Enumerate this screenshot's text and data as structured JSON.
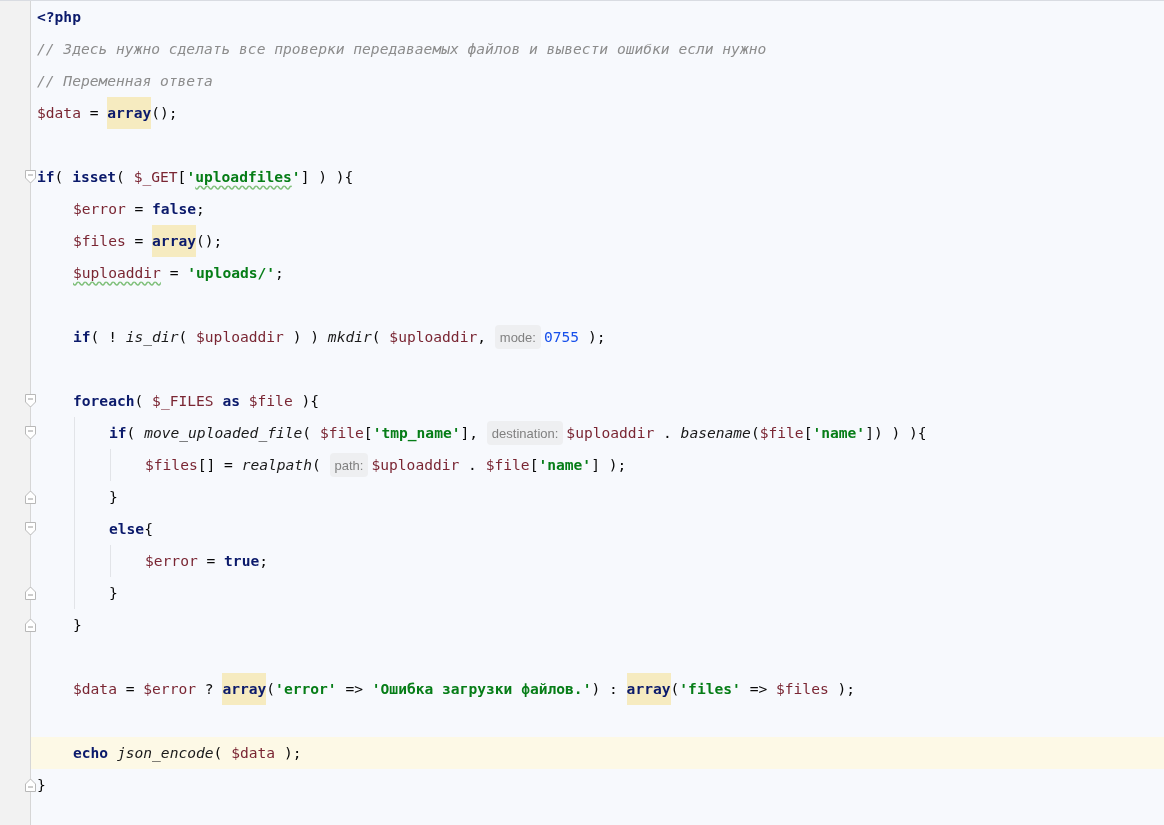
{
  "editor": {
    "lines": [
      {
        "kind": "code",
        "tokens": [
          {
            "kind": "keyword",
            "text": "<?php"
          }
        ]
      },
      {
        "kind": "code",
        "tokens": [
          {
            "kind": "comment",
            "text": "// Здесь нужно сделать все проверки передаваемых файлов и вывести ошибки если нужно"
          }
        ]
      },
      {
        "kind": "code",
        "tokens": [
          {
            "kind": "comment",
            "text": "// Переменная ответа"
          }
        ]
      },
      {
        "kind": "code",
        "tokens": [
          {
            "kind": "variable",
            "text": "$data"
          },
          {
            "kind": "plain",
            "text": " = "
          },
          {
            "kind": "marked",
            "text": "array"
          },
          {
            "kind": "plain",
            "text": "();"
          }
        ]
      },
      {
        "kind": "blank"
      },
      {
        "kind": "block_open",
        "tokens": [
          {
            "kind": "keyword",
            "text": "if"
          },
          {
            "kind": "plain",
            "text": "( "
          },
          {
            "kind": "keyword",
            "text": "isset"
          },
          {
            "kind": "plain",
            "text": "( "
          },
          {
            "kind": "variable",
            "text": "$_GET"
          },
          {
            "kind": "plain",
            "text": "["
          },
          {
            "kind": "string",
            "text": "'"
          },
          {
            "kind": "string_typo",
            "text": "uploadfiles"
          },
          {
            "kind": "string",
            "text": "'"
          },
          {
            "kind": "plain",
            "text": "] ) ){"
          }
        ],
        "children": [
          {
            "kind": "code",
            "tokens": [
              {
                "kind": "variable",
                "text": "$error"
              },
              {
                "kind": "plain",
                "text": " = "
              },
              {
                "kind": "keyword",
                "text": "false"
              },
              {
                "kind": "plain",
                "text": ";"
              }
            ]
          },
          {
            "kind": "code",
            "tokens": [
              {
                "kind": "variable",
                "text": "$files"
              },
              {
                "kind": "plain",
                "text": " = "
              },
              {
                "kind": "marked",
                "text": "array"
              },
              {
                "kind": "plain",
                "text": "();"
              }
            ]
          },
          {
            "kind": "code",
            "tokens": [
              {
                "kind": "variable_typo",
                "text": "$uploaddir"
              },
              {
                "kind": "plain",
                "text": " = "
              },
              {
                "kind": "string",
                "text": "'uploads/'"
              },
              {
                "kind": "plain",
                "text": ";"
              }
            ]
          },
          {
            "kind": "blank"
          },
          {
            "kind": "code",
            "tokens": [
              {
                "kind": "keyword",
                "text": "if"
              },
              {
                "kind": "plain",
                "text": "( ! "
              },
              {
                "kind": "function",
                "text": "is_dir"
              },
              {
                "kind": "plain",
                "text": "( "
              },
              {
                "kind": "variable",
                "text": "$uploaddir"
              },
              {
                "kind": "plain",
                "text": " ) ) "
              },
              {
                "kind": "function",
                "text": "mkdir"
              },
              {
                "kind": "plain",
                "text": "( "
              },
              {
                "kind": "variable",
                "text": "$uploaddir"
              },
              {
                "kind": "plain",
                "text": ", "
              },
              {
                "kind": "hint",
                "text": "mode:"
              },
              {
                "kind": "number",
                "text": "0755"
              },
              {
                "kind": "plain",
                "text": " );"
              }
            ]
          },
          {
            "kind": "blank"
          },
          {
            "kind": "block_open",
            "tokens": [
              {
                "kind": "keyword",
                "text": "foreach"
              },
              {
                "kind": "plain",
                "text": "( "
              },
              {
                "kind": "variable",
                "text": "$_FILES"
              },
              {
                "kind": "keyword",
                "text": " as "
              },
              {
                "kind": "variable",
                "text": "$file"
              },
              {
                "kind": "plain",
                "text": " ){"
              }
            ],
            "children": [
              {
                "kind": "block_open",
                "tokens": [
                  {
                    "kind": "keyword",
                    "text": "if"
                  },
                  {
                    "kind": "plain",
                    "text": "( "
                  },
                  {
                    "kind": "function",
                    "text": "move_uploaded_file"
                  },
                  {
                    "kind": "plain",
                    "text": "( "
                  },
                  {
                    "kind": "variable",
                    "text": "$file"
                  },
                  {
                    "kind": "plain",
                    "text": "["
                  },
                  {
                    "kind": "string",
                    "text": "'tmp_name'"
                  },
                  {
                    "kind": "plain",
                    "text": "], "
                  },
                  {
                    "kind": "hint",
                    "text": "destination:"
                  },
                  {
                    "kind": "variable",
                    "text": "$uploaddir"
                  },
                  {
                    "kind": "plain",
                    "text": " . "
                  },
                  {
                    "kind": "function",
                    "text": "basename"
                  },
                  {
                    "kind": "plain",
                    "text": "("
                  },
                  {
                    "kind": "variable",
                    "text": "$file"
                  },
                  {
                    "kind": "plain",
                    "text": "["
                  },
                  {
                    "kind": "string",
                    "text": "'name'"
                  },
                  {
                    "kind": "plain",
                    "text": "]) ) ){"
                  }
                ],
                "children": [
                  {
                    "kind": "code",
                    "tokens": [
                      {
                        "kind": "variable",
                        "text": "$files"
                      },
                      {
                        "kind": "plain",
                        "text": "[] = "
                      },
                      {
                        "kind": "function",
                        "text": "realpath"
                      },
                      {
                        "kind": "plain",
                        "text": "( "
                      },
                      {
                        "kind": "hint",
                        "text": "path:"
                      },
                      {
                        "kind": "variable",
                        "text": "$uploaddir"
                      },
                      {
                        "kind": "plain",
                        "text": " . "
                      },
                      {
                        "kind": "variable",
                        "text": "$file"
                      },
                      {
                        "kind": "plain",
                        "text": "["
                      },
                      {
                        "kind": "string",
                        "text": "'name'"
                      },
                      {
                        "kind": "plain",
                        "text": "] );"
                      }
                    ]
                  }
                ]
              },
              {
                "kind": "block_close",
                "tokens": [
                  {
                    "kind": "plain",
                    "text": "}"
                  }
                ]
              },
              {
                "kind": "block_open",
                "tokens": [
                  {
                    "kind": "keyword",
                    "text": "else"
                  },
                  {
                    "kind": "plain",
                    "text": "{"
                  }
                ],
                "children": [
                  {
                    "kind": "code",
                    "tokens": [
                      {
                        "kind": "variable",
                        "text": "$error"
                      },
                      {
                        "kind": "plain",
                        "text": " = "
                      },
                      {
                        "kind": "keyword",
                        "text": "true"
                      },
                      {
                        "kind": "plain",
                        "text": ";"
                      }
                    ]
                  }
                ]
              },
              {
                "kind": "block_close",
                "tokens": [
                  {
                    "kind": "plain",
                    "text": "}"
                  }
                ]
              }
            ]
          },
          {
            "kind": "block_close",
            "tokens": [
              {
                "kind": "plain",
                "text": "}"
              }
            ]
          },
          {
            "kind": "blank"
          },
          {
            "kind": "code",
            "tokens": [
              {
                "kind": "variable",
                "text": "$data"
              },
              {
                "kind": "plain",
                "text": " = "
              },
              {
                "kind": "variable",
                "text": "$error"
              },
              {
                "kind": "plain",
                "text": " ? "
              },
              {
                "kind": "marked",
                "text": "array"
              },
              {
                "kind": "plain",
                "text": "("
              },
              {
                "kind": "string",
                "text": "'error'"
              },
              {
                "kind": "plain",
                "text": " => "
              },
              {
                "kind": "string",
                "text": "'Ошибка загрузки файлов.'"
              },
              {
                "kind": "plain",
                "text": ") : "
              },
              {
                "kind": "marked",
                "text": "array"
              },
              {
                "kind": "plain",
                "text": "("
              },
              {
                "kind": "string",
                "text": "'files'"
              },
              {
                "kind": "plain",
                "text": " => "
              },
              {
                "kind": "variable",
                "text": "$files"
              },
              {
                "kind": "plain",
                "text": " );"
              }
            ]
          },
          {
            "kind": "blank"
          },
          {
            "kind": "code",
            "current": true,
            "tokens": [
              {
                "kind": "keyword",
                "text": "echo"
              },
              {
                "kind": "function",
                "text": " json_encode"
              },
              {
                "kind": "plain",
                "text": "( "
              },
              {
                "kind": "variable",
                "text": "$data"
              },
              {
                "kind": "plain",
                "text": " );"
              }
            ]
          }
        ]
      },
      {
        "kind": "block_close",
        "tokens": [
          {
            "kind": "plain",
            "text": "}"
          }
        ]
      }
    ]
  }
}
